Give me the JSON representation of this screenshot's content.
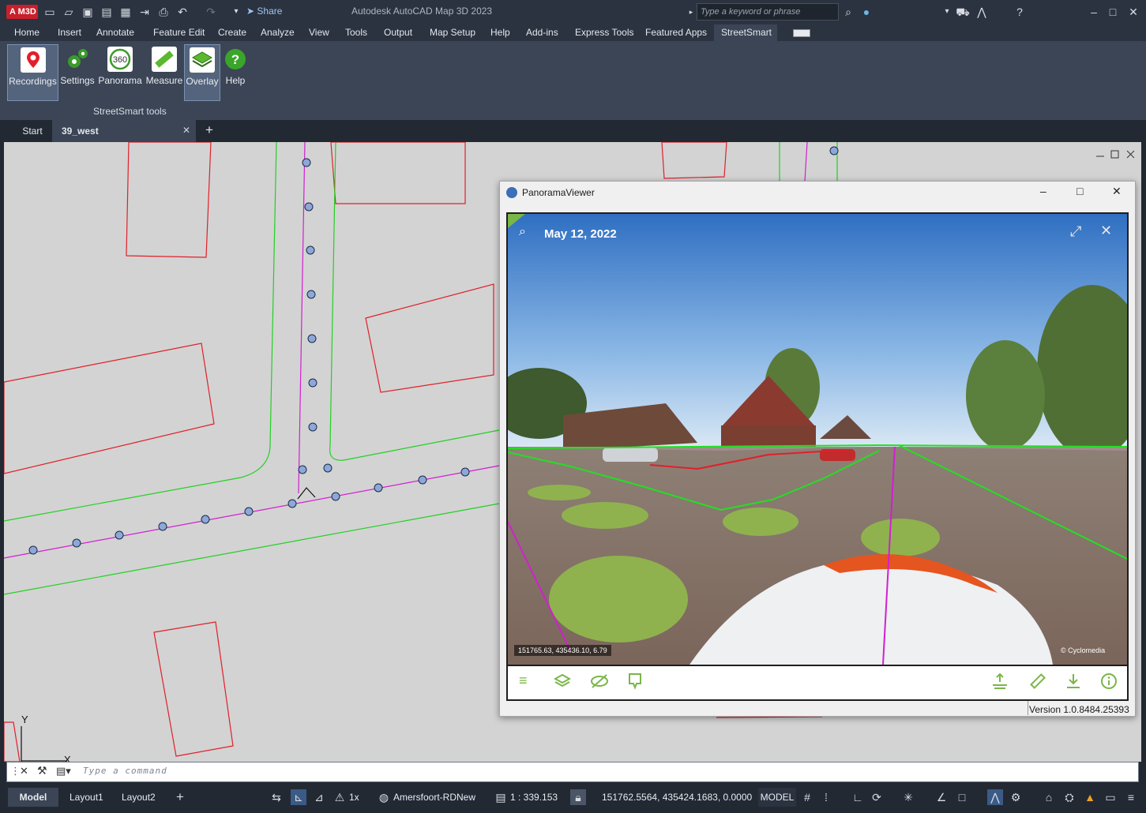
{
  "titlebar": {
    "logo": "A M3D",
    "share": "Share",
    "app_title": "Autodesk AutoCAD Map 3D 2023",
    "search_placeholder": "Type a keyword or phrase"
  },
  "menu": [
    "Home",
    "Insert",
    "Annotate",
    "Feature Edit",
    "Create",
    "Analyze",
    "View",
    "Tools",
    "Output",
    "Map Setup",
    "Help",
    "Add-ins",
    "Express Tools",
    "Featured Apps",
    "StreetSmart"
  ],
  "ribbon": {
    "buttons": [
      "Recordings",
      "Settings",
      "Panorama",
      "Measure",
      "Overlay",
      "Help"
    ],
    "panel_label": "StreetSmart tools"
  },
  "doc_tabs": {
    "start": "Start",
    "active": "39_west"
  },
  "panorama": {
    "window_title": "PanoramaViewer",
    "date": "May 12, 2022",
    "coords": "151765.63, 435436.10, 6.79",
    "copyright": "© Cyclomedia",
    "version": "Version 1.0.8484.25393"
  },
  "command": {
    "placeholder": "Type a command"
  },
  "status": {
    "tabs": [
      "Model",
      "Layout1",
      "Layout2"
    ],
    "annotation_scale": "1x",
    "coord_system": "Amersfoort-RDNew",
    "scale": "1 : 339.153",
    "coordinates": "151762.5564, 435424.1683, 0.0000",
    "model": "MODEL"
  },
  "colors": {
    "accent_green": "#7ab648",
    "line_red": "#e0202a",
    "line_green": "#22d022",
    "line_magenta": "#d21fd2"
  }
}
